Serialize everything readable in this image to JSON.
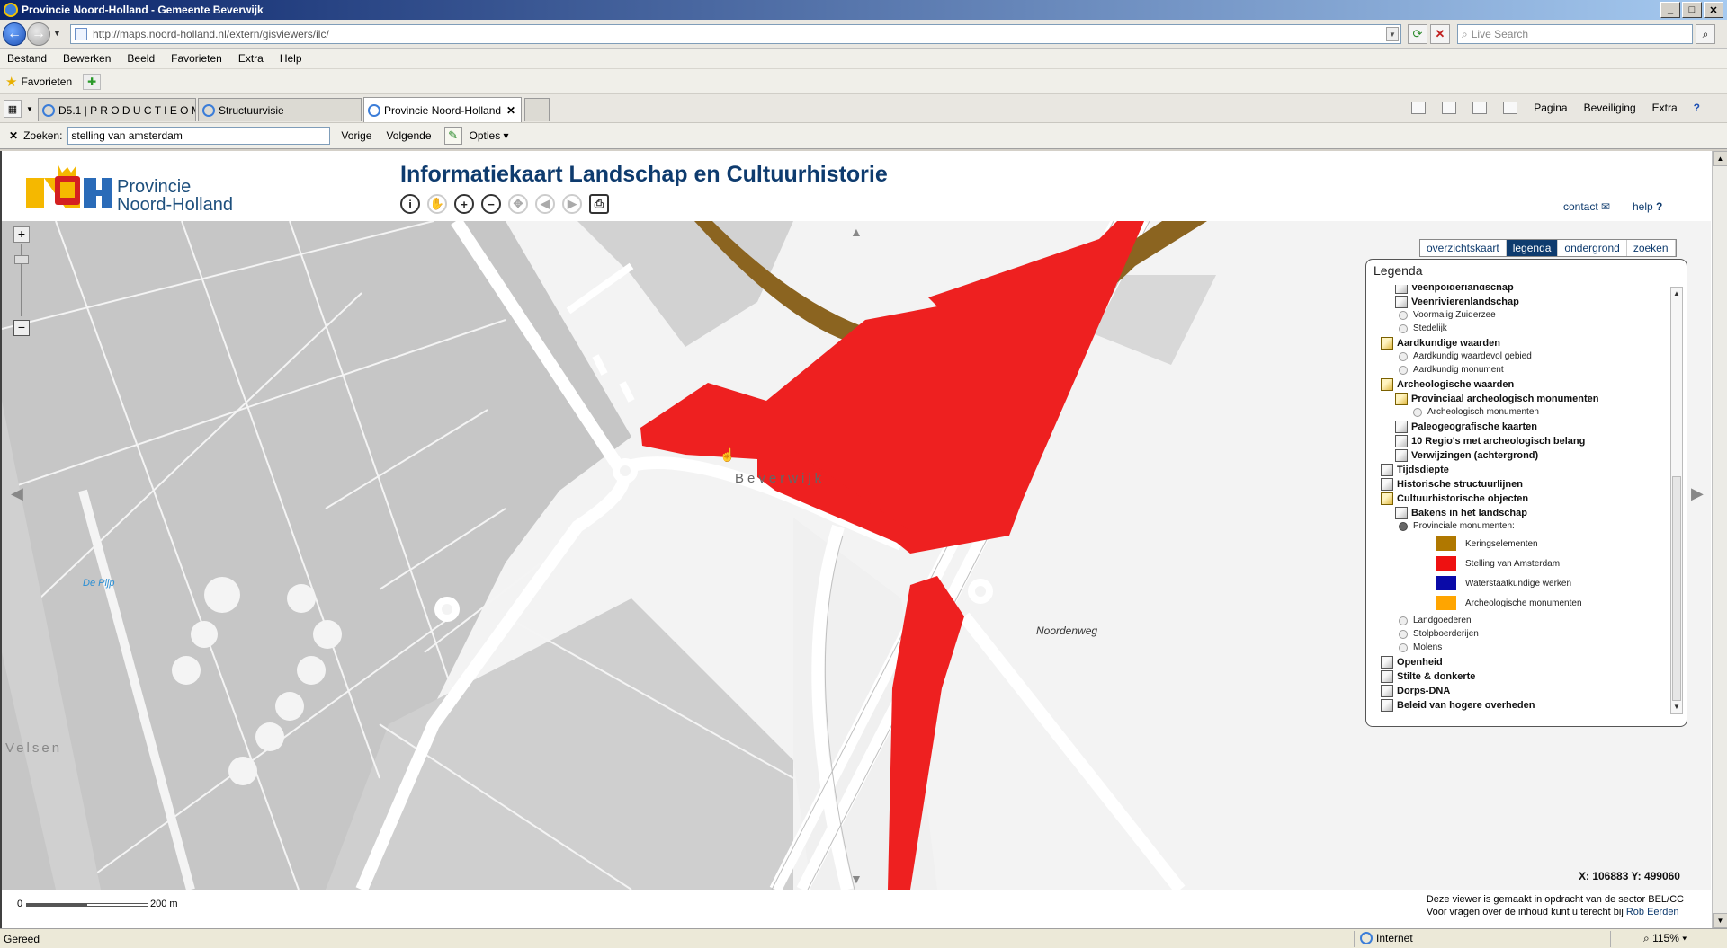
{
  "window": {
    "title": "Provincie Noord-Holland - Gemeente Beverwijk",
    "min": "_",
    "max": "□",
    "close": "✕"
  },
  "address": {
    "url": "http://maps.noord-holland.nl/extern/gisviewers/ilc/",
    "search_placeholder": "Live Search"
  },
  "menu": [
    "Bestand",
    "Bewerken",
    "Beeld",
    "Favorieten",
    "Extra",
    "Help"
  ],
  "favorites": {
    "label": "Favorieten"
  },
  "tabs": [
    {
      "label": "D5.1 | P R O D U C T I E O M...",
      "active": false
    },
    {
      "label": "Structuurvisie",
      "active": false
    },
    {
      "label": "Provincie Noord-Holland",
      "active": true
    }
  ],
  "command_bar": {
    "page": "Pagina",
    "safety": "Beveiliging",
    "tools": "Extra",
    "help": "?"
  },
  "find": {
    "label": "Zoeken:",
    "value": "stelling van amsterdam",
    "prev": "Vorige",
    "next": "Volgende",
    "options": "Opties"
  },
  "header": {
    "province_line1": "Provincie",
    "province_line2": "Noord-Holland",
    "app_title": "Informatiekaart Landschap en Cultuurhistorie",
    "tools": [
      {
        "icon": "info-icon",
        "glyph": "i",
        "enabled": true
      },
      {
        "icon": "hand-pan-icon",
        "glyph": "✋",
        "enabled": false
      },
      {
        "icon": "zoom-in-icon",
        "glyph": "+",
        "enabled": true
      },
      {
        "icon": "zoom-out-icon",
        "glyph": "−",
        "enabled": true
      },
      {
        "icon": "full-extent-icon",
        "glyph": "✥",
        "enabled": false
      },
      {
        "icon": "previous-extent-icon",
        "glyph": "◀",
        "enabled": false
      },
      {
        "icon": "next-extent-icon",
        "glyph": "▶",
        "enabled": false
      },
      {
        "icon": "print-icon",
        "glyph": "⎙",
        "enabled": true
      }
    ],
    "contact": "contact",
    "help": "help"
  },
  "map": {
    "labels": {
      "beverwijk": "Beverwijk",
      "noordenweg": "Noordenweg",
      "de_pijp": "De Pijp",
      "velsen": "Velsen"
    },
    "coords": "X: 106883   Y: 499060",
    "colors": {
      "stelling": "#ee2020",
      "kering": "#8b6420",
      "background": "#f3f3f3",
      "block": "#c6c6c6"
    }
  },
  "legend": {
    "tabs": [
      "overzichtskaart",
      "legenda",
      "ondergrond",
      "zoeken"
    ],
    "active_tab": "legenda",
    "title": "Legenda",
    "items": [
      {
        "type": "folder",
        "state": "closed",
        "level": 1,
        "label": "Veenpolderlandschap",
        "bold": true
      },
      {
        "type": "folder",
        "state": "closed",
        "level": 1,
        "label": "Veenrivierenlandschap",
        "bold": true
      },
      {
        "type": "radio",
        "level": 1,
        "label": "Voormalig Zuiderzee"
      },
      {
        "type": "radio",
        "level": 1,
        "label": "Stedelijk"
      },
      {
        "type": "folder",
        "state": "open",
        "level": 0,
        "label": "Aardkundige waarden",
        "bold": true
      },
      {
        "type": "radio",
        "level": 1,
        "label": "Aardkundig waardevol gebied"
      },
      {
        "type": "radio",
        "level": 1,
        "label": "Aardkundig monument"
      },
      {
        "type": "folder",
        "state": "open",
        "level": 0,
        "label": "Archeologische waarden",
        "bold": true
      },
      {
        "type": "folder",
        "state": "open",
        "level": 1,
        "label": "Provinciaal archeologisch monumenten",
        "bold": true
      },
      {
        "type": "radio",
        "level": 2,
        "label": "Archeologisch monumenten"
      },
      {
        "type": "folder",
        "state": "closed",
        "level": 1,
        "label": "Paleogeografische kaarten",
        "bold": true
      },
      {
        "type": "folder",
        "state": "closed",
        "level": 1,
        "label": "10 Regio's met archeologisch belang",
        "bold": true
      },
      {
        "type": "folder",
        "state": "closed",
        "level": 1,
        "label": "Verwijzingen (achtergrond)",
        "bold": true
      },
      {
        "type": "folder",
        "state": "closed",
        "level": 0,
        "label": "Tijdsdiepte",
        "bold": true
      },
      {
        "type": "folder",
        "state": "closed",
        "level": 0,
        "label": "Historische structuurlijnen",
        "bold": true
      },
      {
        "type": "folder",
        "state": "open",
        "level": 0,
        "label": "Cultuurhistorische objecten",
        "bold": true
      },
      {
        "type": "folder",
        "state": "closed",
        "level": 1,
        "label": "Bakens in het landschap",
        "bold": true
      },
      {
        "type": "radio",
        "level": 1,
        "label": "Provinciale monumenten:",
        "selected": true
      },
      {
        "type": "swatch",
        "level": 2,
        "label": "Keringselementen",
        "color": "#b07800"
      },
      {
        "type": "swatch",
        "level": 2,
        "label": "Stelling van Amsterdam",
        "color": "#ee1111"
      },
      {
        "type": "swatch",
        "level": 2,
        "label": "Waterstaatkundige werken",
        "color": "#0a0aa8"
      },
      {
        "type": "swatch",
        "level": 2,
        "label": "Archeologische monumenten",
        "color": "#ffa500"
      },
      {
        "type": "radio",
        "level": 1,
        "label": "Landgoederen"
      },
      {
        "type": "radio",
        "level": 1,
        "label": "Stolpboerderijen"
      },
      {
        "type": "radio",
        "level": 1,
        "label": "Molens"
      },
      {
        "type": "folder",
        "state": "closed",
        "level": 0,
        "label": "Openheid",
        "bold": true
      },
      {
        "type": "folder",
        "state": "closed",
        "level": 0,
        "label": "Stilte & donkerte",
        "bold": true
      },
      {
        "type": "folder",
        "state": "closed",
        "level": 0,
        "label": "Dorps-DNA",
        "bold": true
      },
      {
        "type": "folder",
        "state": "closed",
        "level": 0,
        "label": "Beleid van hogere overheden",
        "bold": true
      }
    ]
  },
  "footer": {
    "scale_start": "0",
    "scale_end": "200 m",
    "note_line1": "Deze viewer is gemaakt in opdracht van de sector BEL/CC",
    "note_line2_prefix": "Voor vragen over de inhoud kunt u terecht bij",
    "note_link": "Rob Eerden"
  },
  "status": {
    "text": "Gereed",
    "zone": "Internet",
    "zoom": "115%"
  }
}
